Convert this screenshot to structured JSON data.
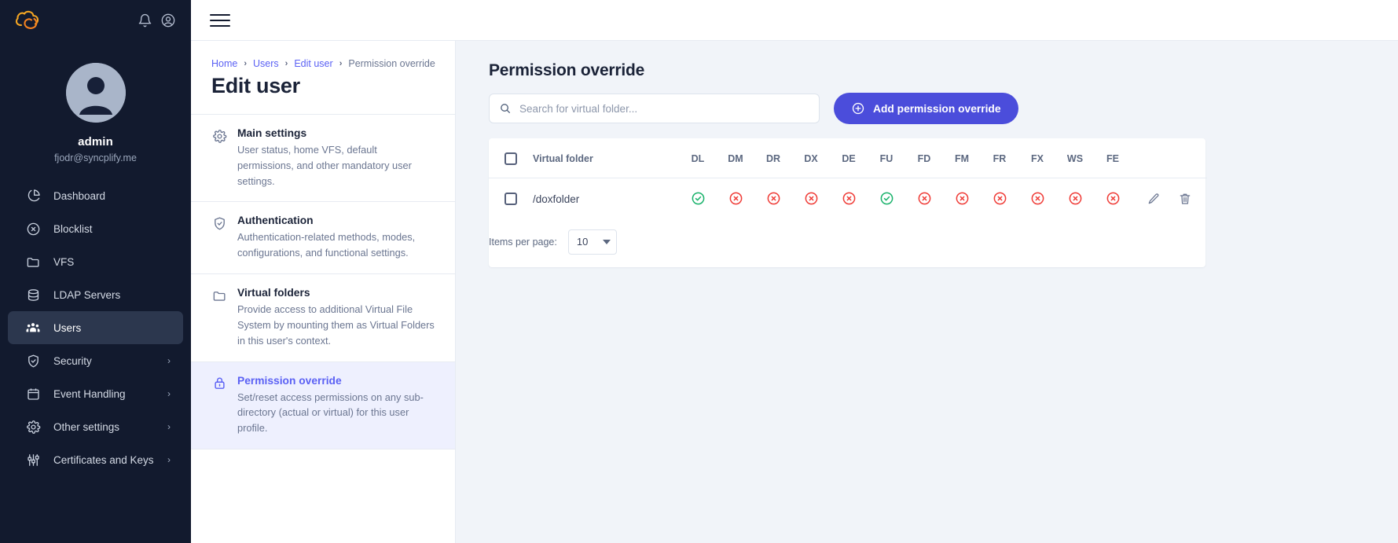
{
  "brand": {
    "logo_icon": "syncplify-cloud-logo",
    "accent": "#4b4ddb",
    "sidebar_bg": "#121a2e"
  },
  "sidebar": {
    "top_icons": [
      {
        "name": "notifications-icon",
        "glyph": "bell"
      },
      {
        "name": "account-icon",
        "glyph": "user-circle"
      }
    ],
    "profile": {
      "avatar_icon": "user-avatar",
      "name": "admin",
      "email": "fjodr@syncplify.me"
    },
    "items": [
      {
        "label": "Dashboard",
        "icon": "pie-chart-icon",
        "active": false,
        "expandable": false
      },
      {
        "label": "Blocklist",
        "icon": "ban-circle-icon",
        "active": false,
        "expandable": false
      },
      {
        "label": "VFS",
        "icon": "folder-icon",
        "active": false,
        "expandable": false
      },
      {
        "label": "LDAP Servers",
        "icon": "database-icon",
        "active": false,
        "expandable": false
      },
      {
        "label": "Users",
        "icon": "users-icon",
        "active": true,
        "expandable": false
      },
      {
        "label": "Security",
        "icon": "shield-check-icon",
        "active": false,
        "expandable": true
      },
      {
        "label": "Event Handling",
        "icon": "calendar-icon",
        "active": false,
        "expandable": true
      },
      {
        "label": "Other settings",
        "icon": "gear-icon",
        "active": false,
        "expandable": true
      },
      {
        "label": "Certificates and Keys",
        "icon": "sliders-icon",
        "active": false,
        "expandable": true
      }
    ],
    "chevron_glyph": "›"
  },
  "topbar": {
    "menu_icon": "hamburger-menu-icon"
  },
  "breadcrumb": {
    "separator": "›",
    "items": [
      {
        "label": "Home",
        "link": true
      },
      {
        "label": "Users",
        "link": true
      },
      {
        "label": "Edit user",
        "link": true
      },
      {
        "label": "Permission override",
        "link": false
      }
    ]
  },
  "page": {
    "title": "Edit user"
  },
  "settings_menu": [
    {
      "title": "Main settings",
      "desc": "User status, home VFS, default permissions, and other mandatory user settings.",
      "icon": "gear-icon",
      "active": false
    },
    {
      "title": "Authentication",
      "desc": "Authentication-related methods, modes, configurations, and functional settings.",
      "icon": "shield-check-icon",
      "active": false
    },
    {
      "title": "Virtual folders",
      "desc": "Provide access to additional Virtual File System by mounting them as Virtual Folders in this user's context.",
      "icon": "folder-icon",
      "active": false
    },
    {
      "title": "Permission override",
      "desc": "Set/reset access permissions on any sub-directory (actual or virtual) for this user profile.",
      "icon": "lock-icon",
      "active": true
    }
  ],
  "content": {
    "heading": "Permission override",
    "search": {
      "placeholder": "Search for virtual folder...",
      "value": "",
      "icon": "search-icon"
    },
    "add_button": {
      "label": "Add permission override",
      "icon": "plus-circle-icon"
    },
    "table": {
      "select_all_checked": false,
      "columns": [
        {
          "key": "folder",
          "label": "Virtual folder"
        },
        {
          "key": "DL",
          "label": "DL"
        },
        {
          "key": "DM",
          "label": "DM"
        },
        {
          "key": "DR",
          "label": "DR"
        },
        {
          "key": "DX",
          "label": "DX"
        },
        {
          "key": "DE",
          "label": "DE"
        },
        {
          "key": "FU",
          "label": "FU"
        },
        {
          "key": "FD",
          "label": "FD"
        },
        {
          "key": "FM",
          "label": "FM"
        },
        {
          "key": "FR",
          "label": "FR"
        },
        {
          "key": "FX",
          "label": "FX"
        },
        {
          "key": "WS",
          "label": "WS"
        },
        {
          "key": "FE",
          "label": "FE"
        }
      ],
      "rows": [
        {
          "folder": "/doxfolder",
          "checked": false,
          "perms": {
            "DL": true,
            "DM": false,
            "DR": false,
            "DX": false,
            "DE": false,
            "FU": true,
            "FD": false,
            "FM": false,
            "FR": false,
            "FX": false,
            "WS": false,
            "FE": false
          },
          "actions": [
            {
              "name": "edit-row-button",
              "icon": "pencil-icon"
            },
            {
              "name": "delete-row-button",
              "icon": "trash-icon"
            }
          ]
        }
      ],
      "allow_icon": "check-circle-icon",
      "deny_icon": "x-circle-icon",
      "allow_color": "#19b26b",
      "deny_color": "#ef3b36"
    },
    "pagination": {
      "items_per_page_label": "Items per page:",
      "items_per_page_value": "10"
    }
  }
}
